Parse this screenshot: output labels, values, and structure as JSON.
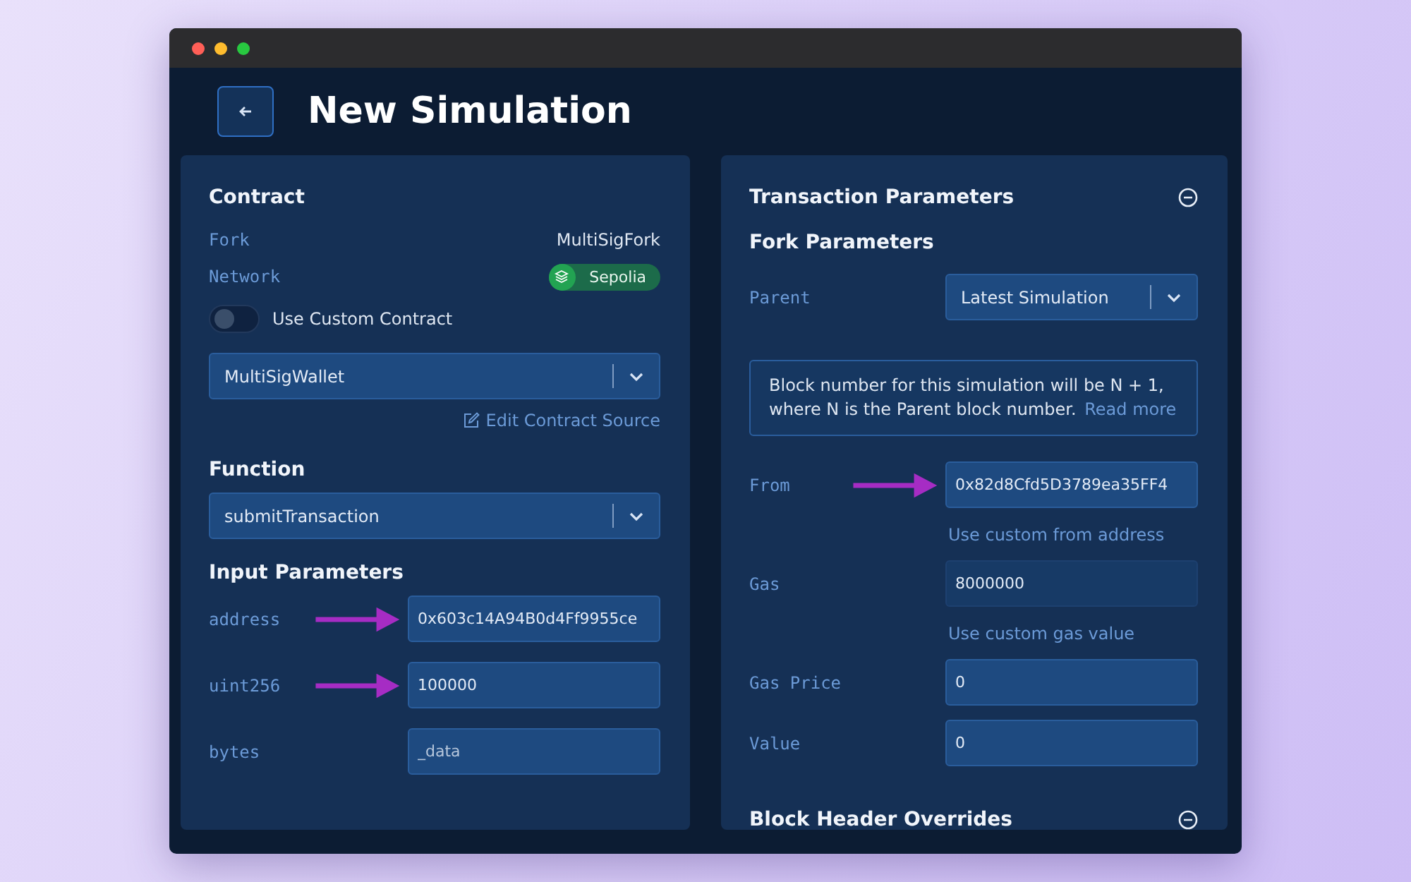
{
  "window": {
    "title": "New Simulation"
  },
  "contract": {
    "heading": "Contract",
    "fork": {
      "label": "Fork",
      "value": "MultiSigFork"
    },
    "network": {
      "label": "Network",
      "value": "Sepolia"
    },
    "custom_contract": {
      "label": "Use Custom Contract",
      "on": false
    },
    "contract_select": {
      "value": "MultiSigWallet"
    },
    "edit_link": "Edit Contract Source"
  },
  "function": {
    "heading": "Function",
    "select": {
      "value": "submitTransaction"
    }
  },
  "input_parameters": {
    "heading": "Input Parameters",
    "params": [
      {
        "label": "address",
        "value": "0x603c14A94B0d4Ff9955ce",
        "arrow": true
      },
      {
        "label": "uint256",
        "value": "100000",
        "arrow": true
      },
      {
        "label": "bytes",
        "placeholder": "_data",
        "arrow": false
      }
    ]
  },
  "transaction_parameters": {
    "heading": "Transaction Parameters",
    "expanded": true,
    "fork_parameters": {
      "heading": "Fork Parameters",
      "parent": {
        "label": "Parent",
        "value": "Latest Simulation"
      },
      "info": {
        "text": "Block number for this simulation will be N + 1, where N is the Parent block number.",
        "link": "Read more"
      }
    },
    "fields": [
      {
        "label": "From",
        "value": "0x82d8Cfd5D3789ea35FF4",
        "arrow": true,
        "disabled": false,
        "hint": "Use custom from address"
      },
      {
        "label": "Gas",
        "value": "8000000",
        "arrow": false,
        "disabled": true,
        "hint": "Use custom gas value"
      },
      {
        "label": "Gas Price",
        "value": "0",
        "arrow": false,
        "disabled": false
      },
      {
        "label": "Value",
        "value": "0",
        "arrow": false,
        "disabled": false
      }
    ]
  },
  "block_header_overrides": {
    "heading": "Block Header Overrides",
    "expanded": true
  }
}
